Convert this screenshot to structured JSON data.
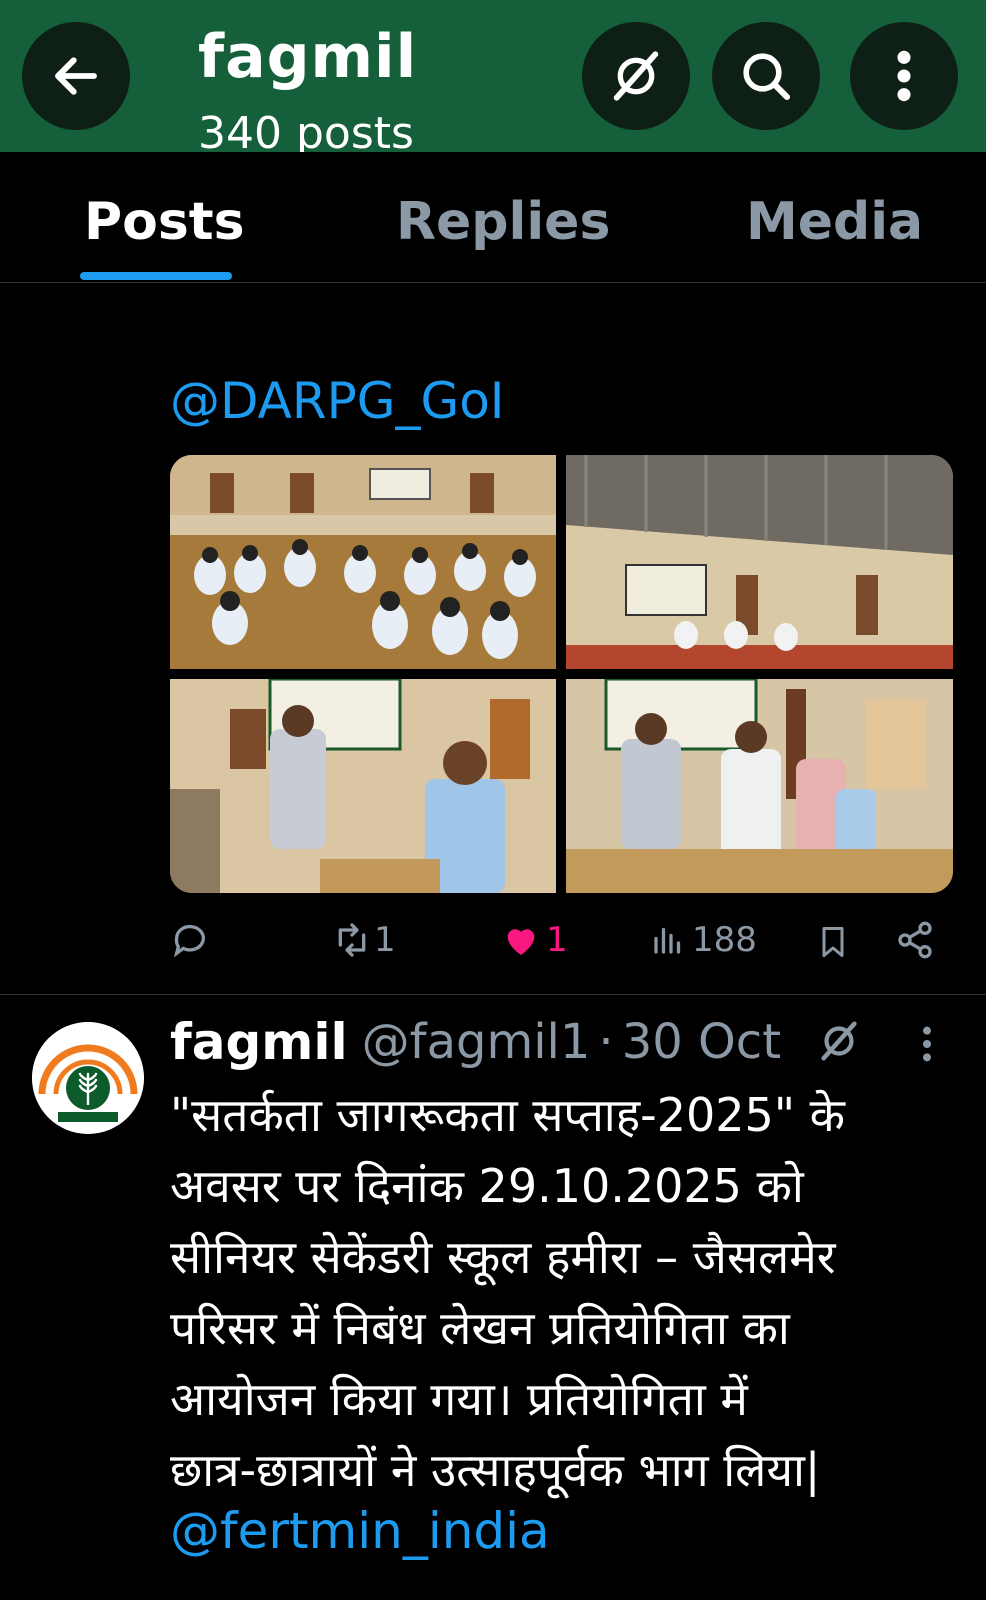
{
  "header": {
    "title": "fagmil",
    "subtitle": "340 posts"
  },
  "tabs": [
    {
      "label": "Posts"
    },
    {
      "label": "Replies"
    },
    {
      "label": "Media"
    }
  ],
  "post1": {
    "mention": "@DARPG_GoI",
    "retweets": "1",
    "likes": "1",
    "views": "188"
  },
  "post2": {
    "name": "fagmil",
    "handle": "@fagmil1",
    "separator": "·",
    "time": "30 Oct",
    "text": "\"सतर्कता जागरूकता सप्ताह-2025\" के\nअवसर पर दिनांक 29.10.2025 को\nसीनियर सेकेंडरी स्कूल हमीरा – जैसलमेर\nपरिसर में निबंध लेखन प्रतियोगिता का\nआयोजन किया गया। प्रतियोगिता में\nछात्र-छात्रायों  ने उत्साहपूर्वक भाग लिया|",
    "mention": "@fertmin_india"
  },
  "colors": {
    "header_bg": "#15603a",
    "accent": "#1d9bf0",
    "like": "#f91880",
    "muted": "#8b98a5"
  },
  "icons": [
    "back-arrow-icon",
    "grok-icon",
    "search-icon",
    "more-vertical-icon",
    "reply-icon",
    "retweet-icon",
    "heart-icon",
    "views-icon",
    "bookmark-icon",
    "share-icon"
  ]
}
